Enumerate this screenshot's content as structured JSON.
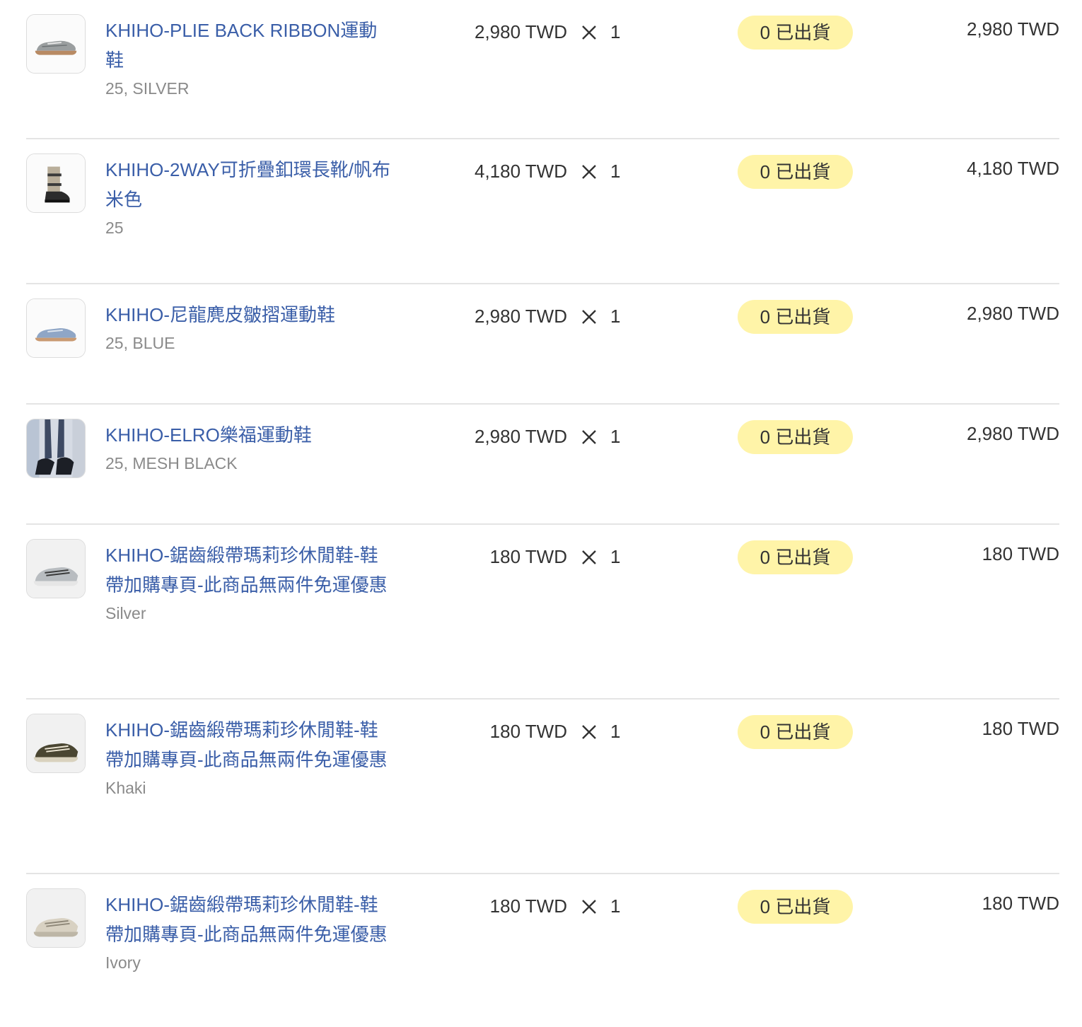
{
  "currency_suffix": "TWD",
  "times_symbol": "times-icon",
  "colors": {
    "link": "#3a5ea8",
    "badge_bg": "#fff4a8",
    "muted": "#8a8a8a",
    "divider": "#e4e4e4"
  },
  "items": [
    {
      "name": "KHIHO-PLIE BACK RIBBON運動鞋",
      "variant": "25, SILVER",
      "price": "2,980 TWD",
      "qty": "1",
      "status": "0 已出貨",
      "total": "2,980 TWD",
      "thumb": "silver-sneaker-icon"
    },
    {
      "name": "KHIHO-2WAY可折疊釦環長靴/帆布米色",
      "variant": "25",
      "price": "4,180 TWD",
      "qty": "1",
      "status": "0 已出貨",
      "total": "4,180 TWD",
      "thumb": "canvas-boot-icon"
    },
    {
      "name": "KHIHO-尼龍麂皮皺摺運動鞋",
      "variant": "25, BLUE",
      "price": "2,980 TWD",
      "qty": "1",
      "status": "0 已出貨",
      "total": "2,980 TWD",
      "thumb": "blue-sneaker-icon"
    },
    {
      "name": "KHIHO-ELRO樂福運動鞋",
      "variant": "25, MESH BLACK",
      "price": "2,980 TWD",
      "qty": "1",
      "status": "0 已出貨",
      "total": "2,980 TWD",
      "thumb": "mesh-loafer-photo-icon"
    },
    {
      "name": "KHIHO-鋸齒緞帶瑪莉珍休閒鞋-鞋帶加購專頁-此商品無兩件免運優惠",
      "variant": "Silver",
      "price": "180 TWD",
      "qty": "1",
      "status": "0 已出貨",
      "total": "180 TWD",
      "thumb": "silver-lace-sneaker-icon"
    },
    {
      "name": "KHIHO-鋸齒緞帶瑪莉珍休閒鞋-鞋帶加購專頁-此商品無兩件免運優惠",
      "variant": "Khaki",
      "price": "180 TWD",
      "qty": "1",
      "status": "0 已出貨",
      "total": "180 TWD",
      "thumb": "khaki-lace-sneaker-icon"
    },
    {
      "name": "KHIHO-鋸齒緞帶瑪莉珍休閒鞋-鞋帶加購專頁-此商品無兩件免運優惠",
      "variant": "Ivory",
      "price": "180 TWD",
      "qty": "1",
      "status": "0 已出貨",
      "total": "180 TWD",
      "thumb": "ivory-lace-sneaker-icon"
    }
  ]
}
